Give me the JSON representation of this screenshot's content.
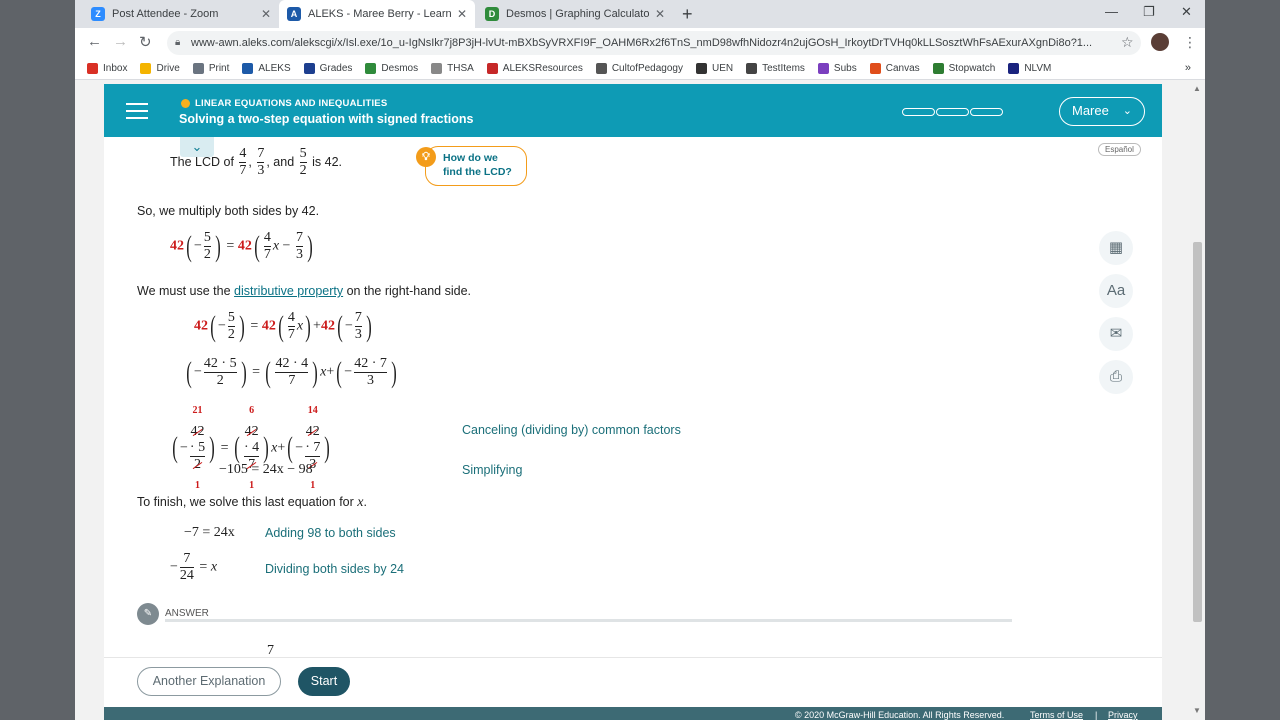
{
  "browser": {
    "tabs": [
      {
        "title": "Post Attendee - Zoom",
        "color": "#2d8cff",
        "glyph": "Z"
      },
      {
        "title": "ALEKS - Maree Berry - Learn",
        "color": "#1d5aa8",
        "glyph": "A"
      },
      {
        "title": "Desmos | Graphing Calculator",
        "color": "#2f8b3b",
        "glyph": "D"
      }
    ],
    "url": "www-awn.aleks.com/alekscgi/x/Isl.exe/1o_u-IgNsIkr7j8P3jH-lvUt-mBXbSyVRXFI9F_OAHM6Rx2f6TnS_nmD98wfhNidozr4n2ujGOsH_IrkoytDrTVHq0kLLSosztWhFsAExurAXgnDi8o?1...",
    "bookmarks": [
      {
        "label": "Inbox",
        "color": "#d93025"
      },
      {
        "label": "Drive",
        "color": "#f4b400"
      },
      {
        "label": "Print",
        "color": "#6a7480"
      },
      {
        "label": "ALEKS",
        "color": "#1d5aa8"
      },
      {
        "label": "Grades",
        "color": "#1d3f8f"
      },
      {
        "label": "Desmos",
        "color": "#2f8b3b"
      },
      {
        "label": "THSA",
        "color": "#888888"
      },
      {
        "label": "ALEKSResources",
        "color": "#c62828"
      },
      {
        "label": "CultofPedagogy",
        "color": "#555555"
      },
      {
        "label": "UEN",
        "color": "#333333"
      },
      {
        "label": "TestItems",
        "color": "#444444"
      },
      {
        "label": "Subs",
        "color": "#7b3fbf"
      },
      {
        "label": "Canvas",
        "color": "#e04e1b"
      },
      {
        "label": "Stopwatch",
        "color": "#2e7d32"
      },
      {
        "label": "NLVM",
        "color": "#1a237e"
      }
    ]
  },
  "header": {
    "topic": "LINEAR EQUATIONS AND INEQUALITIES",
    "title": "Solving a two-step equation with signed fractions",
    "user": "Maree",
    "espanol": "Español"
  },
  "lesson": {
    "lcd_text_1": "The LCD of",
    "lcd_and": ", and",
    "lcd_is": "is 42.",
    "hint_line1": "How do we",
    "hint_line2": "find the LCD?",
    "multiply_text": "So, we multiply both sides by 42.",
    "distrib_before": "We must use the ",
    "distrib_link": "distributive property",
    "distrib_after": " on the right-hand side.",
    "note_cancel": "Canceling (dividing by) common factors",
    "note_simplify": "Simplifying",
    "simplified_eq": "−105 = 24x − 98",
    "finish_text": "To finish, we solve this last equation for",
    "finish_var": "x",
    "step1_eq": "−7 = 24x",
    "step1_note": "Adding 98 to both sides",
    "step2_note": "Dividing both sides by 24",
    "answer_label": "ANSWER",
    "answer_preview": "7"
  },
  "buttons": {
    "another": "Another Explanation",
    "start": "Start"
  },
  "footer": {
    "copyright": "© 2020 McGraw-Hill Education. All Rights Reserved.",
    "terms": "Terms of Use",
    "sep": "|",
    "privacy": "Privacy"
  },
  "colors": {
    "header": "#0e9bb5",
    "accent_red": "#cc1b1b",
    "hint_border": "#f39c1a",
    "start_button": "#1f5565",
    "footer": "#3d6a74"
  }
}
